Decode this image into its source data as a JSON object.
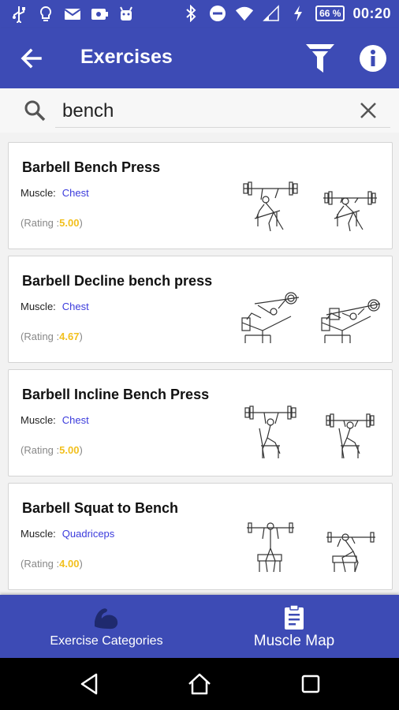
{
  "status_bar": {
    "left_icons": [
      "usb-icon",
      "bulb-icon",
      "mail-icon",
      "cast-icon",
      "android-icon"
    ],
    "right_icons": [
      "bluetooth-icon",
      "do-not-disturb-icon",
      "wifi-icon",
      "signal-icon",
      "charging-icon"
    ],
    "battery": "66 %",
    "time": "00:20"
  },
  "app_bar": {
    "title": "Exercises",
    "back_icon": "arrow-back-icon",
    "filter_icon": "filter-icon",
    "info_icon": "info-icon"
  },
  "search": {
    "value": "bench",
    "icon": "search-icon",
    "clear_icon": "close-icon"
  },
  "labels": {
    "muscle": "Muscle:",
    "rating_prefix": "(Rating :",
    "rating_suffix": ")"
  },
  "exercises": [
    {
      "name": "Barbell Bench Press",
      "muscle": "Chest",
      "rating": "5.00"
    },
    {
      "name": "Barbell Decline bench press",
      "muscle": "Chest",
      "rating": "4.67"
    },
    {
      "name": "Barbell Incline Bench Press",
      "muscle": "Chest",
      "rating": "5.00"
    },
    {
      "name": "Barbell Squat to Bench",
      "muscle": "Quadriceps",
      "rating": "4.00"
    }
  ],
  "bottom_nav": [
    {
      "label": "Exercise Categories",
      "icon": "flexed-arm-icon"
    },
    {
      "label": "Muscle Map",
      "icon": "clipboard-icon"
    }
  ],
  "system_nav": [
    "back-triangle-icon",
    "home-icon",
    "recents-icon"
  ],
  "colors": {
    "primary": "#3d4bb5",
    "muscle_link": "#3b3bdc",
    "rating_value": "#f2c01e",
    "system_nav": "#000000"
  }
}
